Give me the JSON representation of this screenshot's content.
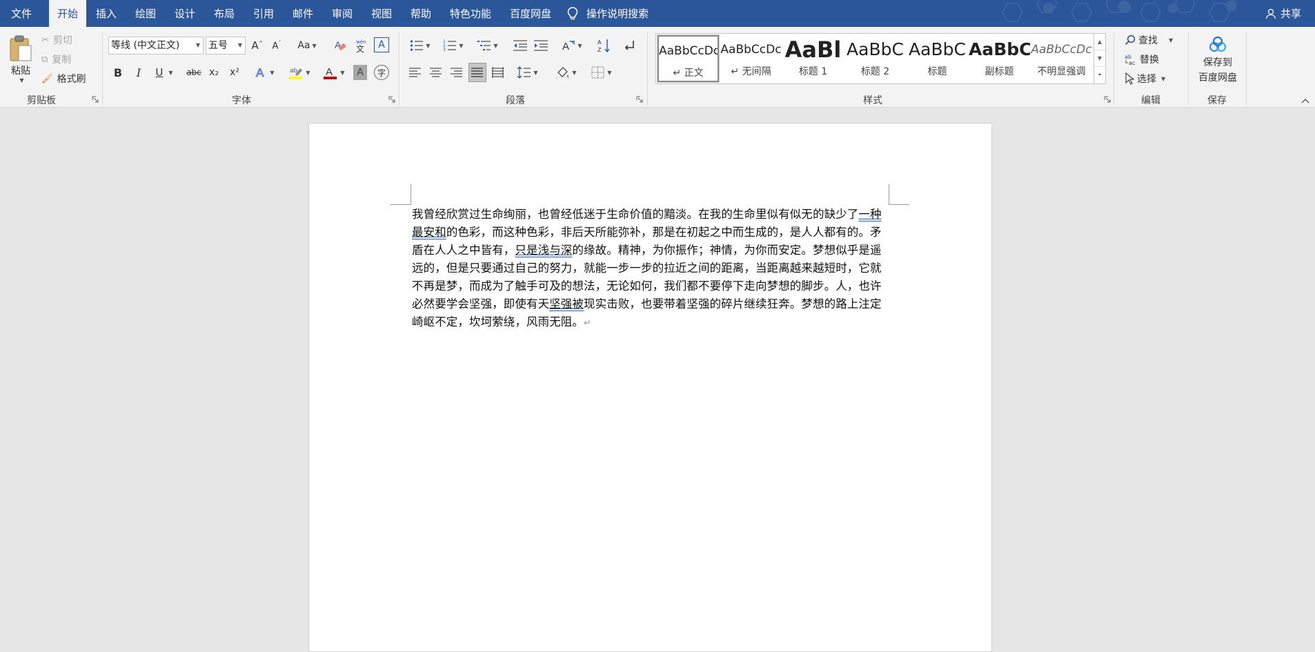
{
  "tabs": [
    {
      "label": "文件",
      "active": false
    },
    {
      "label": "开始",
      "active": true
    },
    {
      "label": "插入",
      "active": false
    },
    {
      "label": "绘图",
      "active": false
    },
    {
      "label": "设计",
      "active": false
    },
    {
      "label": "布局",
      "active": false
    },
    {
      "label": "引用",
      "active": false
    },
    {
      "label": "邮件",
      "active": false
    },
    {
      "label": "审阅",
      "active": false
    },
    {
      "label": "视图",
      "active": false
    },
    {
      "label": "帮助",
      "active": false
    },
    {
      "label": "特色功能",
      "active": false
    },
    {
      "label": "百度网盘",
      "active": false
    }
  ],
  "tell_me": "操作说明搜索",
  "share": "共享",
  "clipboard": {
    "group_label": "剪贴板",
    "paste": "粘贴",
    "cut": "剪切",
    "copy": "复制",
    "format_painter": "格式刷"
  },
  "font": {
    "group_label": "字体",
    "font_name": "等线 (中文正文)",
    "font_size": "五号",
    "bold": "B",
    "italic": "I",
    "underline": "U",
    "strike": "abc",
    "subscript": "x₂",
    "superscript": "x²",
    "case": "Aa",
    "font_color": "#c00000",
    "highlight_color": "#ffff00"
  },
  "paragraph": {
    "group_label": "段落"
  },
  "styles": {
    "group_label": "样式",
    "items": [
      {
        "preview": "AaBbCcDc",
        "name": "↵ 正文",
        "selected": true
      },
      {
        "preview": "AaBbCcDc",
        "name": "↵ 无间隔",
        "selected": false
      },
      {
        "preview": "AaBl",
        "name": "标题 1",
        "selected": false
      },
      {
        "preview": "AaBbC",
        "name": "标题 2",
        "selected": false
      },
      {
        "preview": "AaBbC",
        "name": "标题",
        "selected": false
      },
      {
        "preview": "AaBbC",
        "name": "副标题",
        "selected": false
      },
      {
        "preview": "AaBbCcDc",
        "name": "不明显强调",
        "selected": false
      }
    ]
  },
  "editing": {
    "group_label": "编辑",
    "find": "查找",
    "replace": "替换",
    "select": "选择"
  },
  "save": {
    "group_label": "保存",
    "line1": "保存到",
    "line2": "百度网盘"
  },
  "document": {
    "seg1": "我曾经欣赏过生命绚丽，也曾经低迷于生命价值的黯淡。在我的生命里似有似无的缺少了",
    "u1": "一种最安和",
    "seg2": "的色彩，而这种色彩，非后天所能弥补，那是在初起之中而生成的，是人人都有的。矛盾在人人之中皆有，",
    "u2": "只是浅与深",
    "seg3": "的缘故。精神，为你振作；神情，为你而安定。梦想似乎是遥远的，但是只要通过自己的努力，就能一步一步的拉近之间的距离，当距离越来越短时，它就不再是梦，而成为了触手可及的想法，无论如何，我们都不要停下走向梦想的脚步。人，也许必然要学会坚强，即使有天",
    "u3": "坚强被",
    "seg4": "现实击败，也要带着坚强的碎片继续狂奔。梦想的路上注定崎岖不定，坎坷萦绕，风雨无阻。",
    "para_mark": "↵"
  },
  "colors": {
    "tabbar": "#2b579a",
    "ribbon": "#f3f3f3",
    "workspace": "#e6e6e6"
  }
}
